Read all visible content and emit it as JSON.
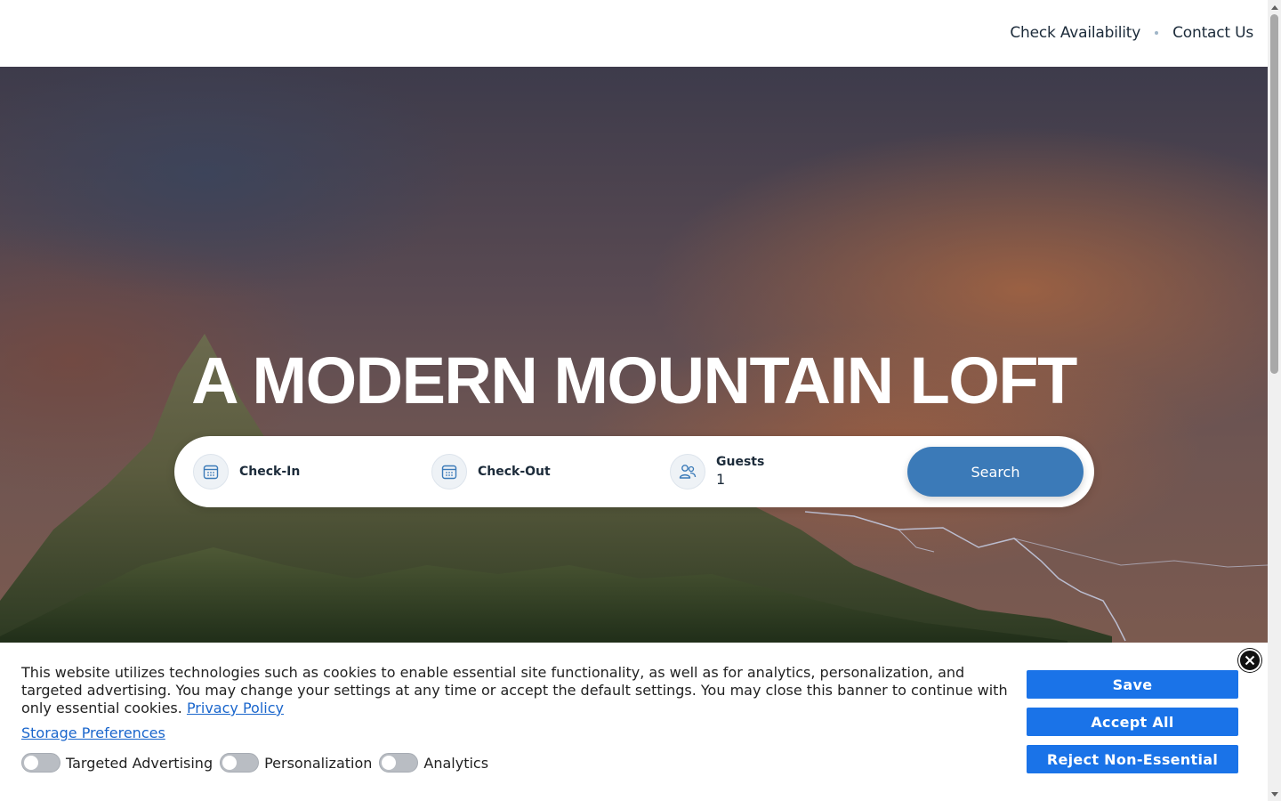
{
  "header": {
    "nav": [
      {
        "label": "Check Availability"
      },
      {
        "label": "Contact Us"
      }
    ]
  },
  "hero": {
    "title": "A MODERN MOUNTAIN LOFT"
  },
  "booking": {
    "check_in_label": "Check-In",
    "check_out_label": "Check-Out",
    "guests_label": "Guests",
    "guests_value": "1",
    "search_label": "Search",
    "icons": [
      "calendar-icon",
      "calendar-icon",
      "guests-icon"
    ]
  },
  "cookie": {
    "text": "This website utilizes technologies such as cookies to enable essential site functionality, as well as for analytics, personalization, and targeted advertising. You may change your settings at any time or accept the default settings. You may close this banner to continue with only essential cookies.",
    "privacy_link": "Privacy Policy",
    "storage_link": "Storage Preferences",
    "toggles": [
      {
        "label": "Targeted Advertising",
        "on": false
      },
      {
        "label": "Personalization",
        "on": false
      },
      {
        "label": "Analytics",
        "on": false
      }
    ],
    "buttons": {
      "save": "Save",
      "accept_all": "Accept All",
      "reject": "Reject Non-Essential"
    },
    "close_icon": "close-icon"
  },
  "colors": {
    "primary_button": "#1a73e8",
    "search_button": "#3b7ab8",
    "link": "#1a66cc",
    "nav_text": "#1c2b3a"
  }
}
